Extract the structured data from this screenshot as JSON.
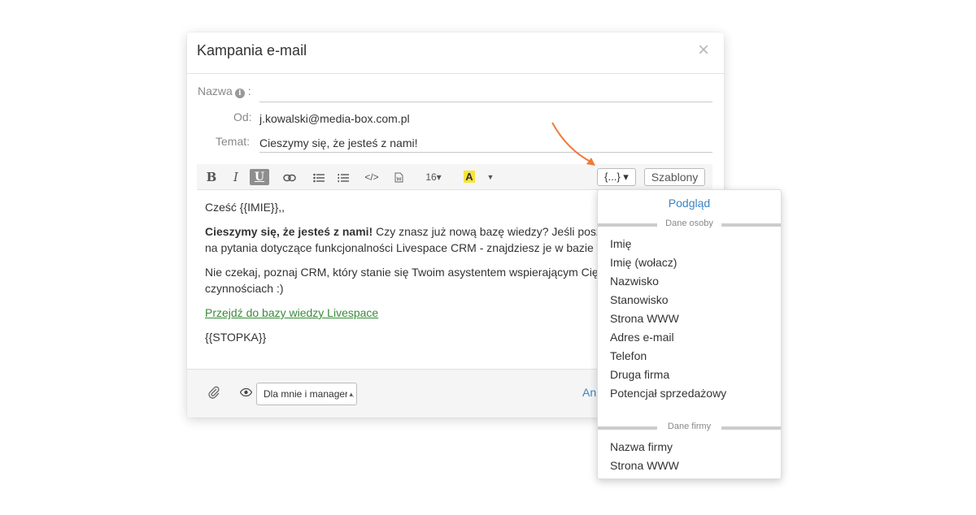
{
  "modal": {
    "title": "Kampania e-mail",
    "close": "×"
  },
  "fields": {
    "name_label": "Nazwa",
    "name_colon": ":",
    "name_value": "",
    "from_label": "Od:",
    "from_value": "j.kowalski@media-box.com.pl",
    "subject_label": "Temat:",
    "subject_value": "Cieszymy się, że jesteś z nami!"
  },
  "toolbar": {
    "bold": "B",
    "italic": "I",
    "underline": "U",
    "code": "</>",
    "font_size": "16▾",
    "color": "A",
    "caret": "▼",
    "variables": "{...} ▾",
    "templates": "Szablony"
  },
  "editor": {
    "greeting": "Cześć {{IMIE}},,",
    "p1_bold": "Cieszymy się, że jesteś z nami!",
    "p1_rest": " Czy znasz już nową bazę wiedzy? Jeśli poszukujesz odpowiedzi",
    "p1_line2": "na pytania dotyczące funkcjonalności Livespace CRM - znajdziesz je w bazie wiedzy.",
    "p2_line1": "Nie czekaj, poznaj CRM, który stanie się Twoim asystentem wspierającym Cię w codziennych",
    "p2_line2": "czynnościach :)",
    "link": "Przejdź do bazy wiedzy Livespace",
    "footer_var": "{{STOPKA}}"
  },
  "footer": {
    "visibility": "Dla mnie i managera",
    "link_partial": "An"
  },
  "dropdown": {
    "preview": "Podgląd",
    "section_person": "Dane osoby",
    "person_items": [
      "Imię",
      "Imię (wołacz)",
      "Nazwisko",
      "Stanowisko",
      "Strona WWW",
      "Adres e-mail",
      "Telefon",
      "Druga firma",
      "Potencjał sprzedażowy"
    ],
    "section_company": "Dane firmy",
    "company_items": [
      "Nazwa firmy",
      "Strona WWW"
    ]
  },
  "colors": {
    "accent_blue": "#3b84c4",
    "link_green": "#3a8a3a",
    "arrow_orange": "#f07a3a"
  }
}
